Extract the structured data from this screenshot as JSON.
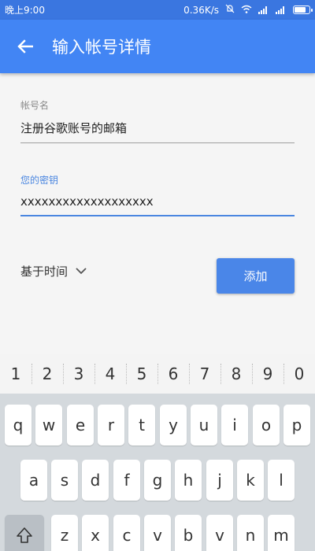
{
  "statusbar": {
    "time": "晚上9:00",
    "net_speed": "0.36K/s",
    "battery_level": 0.8
  },
  "appbar": {
    "title": "输入帐号详情"
  },
  "form": {
    "account_label": "帐号名",
    "account_value": "注册谷歌账号的邮箱",
    "key_label": "您的密钥",
    "key_value": "xxxxxxxxxxxxxxxxxxx"
  },
  "type_select": {
    "selected": "基于时间"
  },
  "add_button": {
    "label": "添加"
  },
  "keyboard": {
    "numbers": [
      "1",
      "2",
      "3",
      "4",
      "5",
      "6",
      "7",
      "8",
      "9",
      "0"
    ],
    "row1": [
      "q",
      "w",
      "e",
      "r",
      "t",
      "y",
      "u",
      "i",
      "o",
      "p"
    ],
    "row2": [
      "a",
      "s",
      "d",
      "f",
      "g",
      "h",
      "j",
      "k",
      "l"
    ],
    "row3": [
      "z",
      "x",
      "c",
      "v",
      "b",
      "n",
      "m"
    ]
  },
  "colors": {
    "statusbar": "#3a76e0",
    "appbar": "#4285f4",
    "accent": "#4a86e8"
  }
}
